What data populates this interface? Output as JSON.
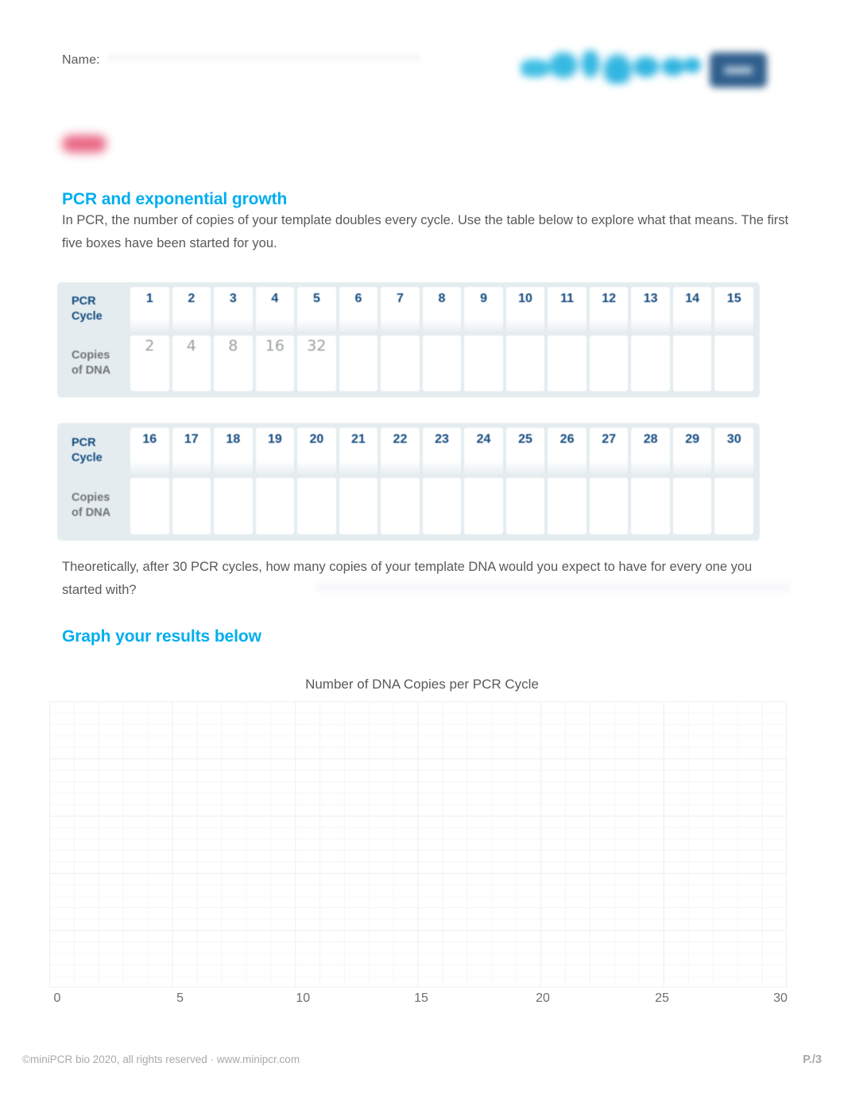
{
  "header": {
    "name_label": "Name:",
    "logo_text": "minipcr",
    "logo_badge_text": "bio",
    "accent_cyan": "#00aeef",
    "navy": "#12497e",
    "pink": "#e8607f"
  },
  "sections": {
    "pcr_growth": {
      "title": "PCR and exponential growth",
      "intro": "In PCR, the number of copies of your template doubles every cycle. Use the table below to explore what that means. The first five boxes have been started for you.",
      "question": "Theoretically, after 30 PCR cycles, how many copies of your template DNA would you expect to have for every one you started with?"
    },
    "graph": {
      "title": "Graph your results below",
      "chart_title": "Number of DNA Copies per PCR Cycle"
    }
  },
  "tables": [
    {
      "cycle_label": "PCR\nCycle",
      "cycle_label_line1": "PCR",
      "cycle_label_line2": "Cycle",
      "copies_label_line1": "Copies",
      "copies_label_line2": "of DNA",
      "cycles": [
        "1",
        "2",
        "3",
        "4",
        "5",
        "6",
        "7",
        "8",
        "9",
        "10",
        "11",
        "12",
        "13",
        "14",
        "15"
      ],
      "copies": [
        "2",
        "4",
        "8",
        "16",
        "32",
        "",
        "",
        "",
        "",
        "",
        "",
        "",
        "",
        "",
        ""
      ]
    },
    {
      "cycle_label_line1": "PCR",
      "cycle_label_line2": "Cycle",
      "copies_label_line1": "Copies",
      "copies_label_line2": "of DNA",
      "cycles": [
        "16",
        "17",
        "18",
        "19",
        "20",
        "21",
        "22",
        "23",
        "24",
        "25",
        "26",
        "27",
        "28",
        "29",
        "30"
      ],
      "copies": [
        "",
        "",
        "",
        "",
        "",
        "",
        "",
        "",
        "",
        "",
        "",
        "",
        "",
        "",
        ""
      ]
    }
  ],
  "chart_data": {
    "type": "line",
    "title": "Number of DNA Copies per PCR Cycle",
    "xlabel": "",
    "ylabel": "",
    "x_ticks": [
      "0",
      "5",
      "10",
      "15",
      "20",
      "25",
      "30"
    ],
    "xlim": [
      0,
      30
    ],
    "grid": true,
    "series": [],
    "note": "blank graph paper grid for student plotting"
  },
  "footer": {
    "copyright": "©miniPCR bio 2020, all rights reserved · www.minipcr.com",
    "page": "P./3"
  }
}
